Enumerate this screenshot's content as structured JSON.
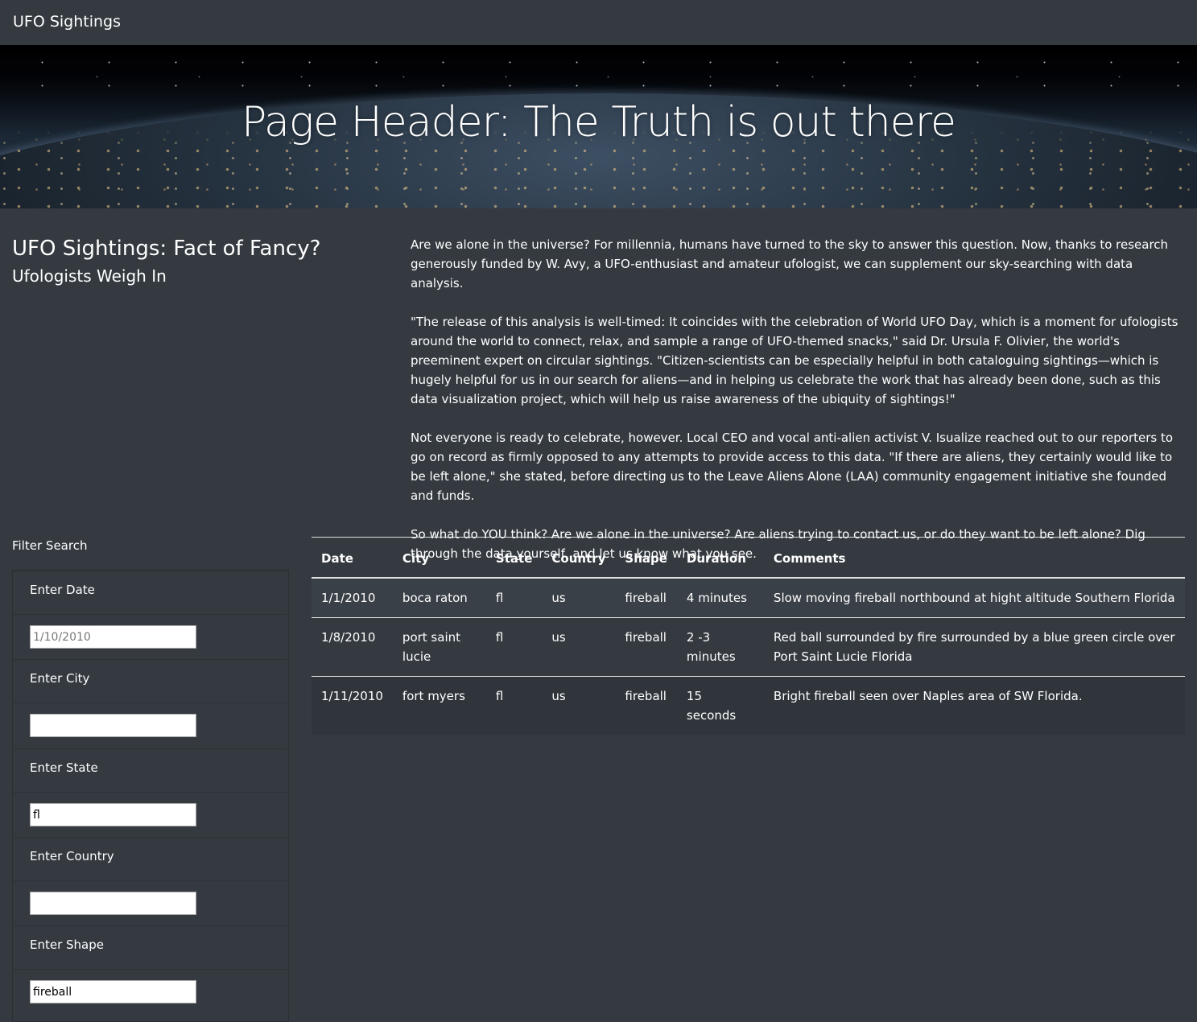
{
  "navbar": {
    "brand": "UFO Sightings"
  },
  "hero": {
    "title": "Page Header: The Truth is out there"
  },
  "intro": {
    "title": "UFO Sightings: Fact of Fancy?",
    "subtitle": "Ufologists Weigh In"
  },
  "article": {
    "paragraphs": [
      "Are we alone in the universe? For millennia, humans have turned to the sky to answer this question. Now, thanks to research generously funded by W. Avy, a UFO-enthusiast and amateur ufologist, we can supplement our sky-searching with data analysis.",
      "\"The release of this analysis is well-timed: It coincides with the celebration of World UFO Day, which is a moment for ufologists around the world to connect, relax, and sample a range of UFO-themed snacks,\" said Dr. Ursula F. Olivier, the world's preeminent expert on circular sightings. \"Citizen-scientists can be especially helpful in both cataloguing sightings—which is hugely helpful for us in our search for aliens—and in helping us celebrate the work that has already been done, such as this data visualization project, which will help us raise awareness of the ubiquity of sightings!\"",
      "Not everyone is ready to celebrate, however. Local CEO and vocal anti-alien activist V. Isualize reached out to our reporters to go on record as firmly opposed to any attempts to provide access to this data. \"If there are aliens, they certainly would like to be left alone,\" she stated, before directing us to the Leave Aliens Alone (LAA) community engagement initiative she founded and funds.",
      "So what do YOU think? Are we alone in the universe? Are aliens trying to contact us, or do they want to be left alone? Dig through the data yourself, and let us know what you see."
    ]
  },
  "filters": {
    "title": "Filter Search",
    "items": [
      {
        "label": "Enter Date",
        "value": "",
        "placeholder": "1/10/2010"
      },
      {
        "label": "Enter City",
        "value": "",
        "placeholder": ""
      },
      {
        "label": "Enter State",
        "value": "fl",
        "placeholder": ""
      },
      {
        "label": "Enter Country",
        "value": "",
        "placeholder": ""
      },
      {
        "label": "Enter Shape",
        "value": "fireball",
        "placeholder": ""
      }
    ]
  },
  "table": {
    "headers": [
      "Date",
      "City",
      "State",
      "Country",
      "Shape",
      "Duration",
      "Comments"
    ],
    "rows": [
      [
        "1/1/2010",
        "boca raton",
        "fl",
        "us",
        "fireball",
        "4 minutes",
        "Slow moving fireball northbound at hight altitude Southern Florida"
      ],
      [
        "1/8/2010",
        "port saint lucie",
        "fl",
        "us",
        "fireball",
        "2 -3 minutes",
        "Red ball surrounded by fire surrounded by a blue green circle over Port Saint Lucie Florida"
      ],
      [
        "1/11/2010",
        "fort myers",
        "fl",
        "us",
        "fireball",
        "15 seconds",
        "Bright fireball seen over Naples area of SW Florida."
      ]
    ]
  },
  "colors": {
    "background": "#343a40",
    "text": "#ffffff"
  }
}
